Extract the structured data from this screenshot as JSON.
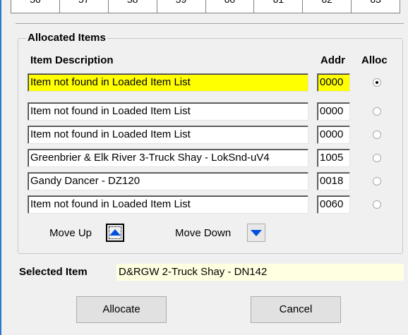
{
  "top_grid": {
    "cells": [
      "56",
      "57",
      "58",
      "59",
      "60",
      "61",
      "62",
      "63"
    ]
  },
  "allocated_items": {
    "group_title": "Allocated Items",
    "headers": {
      "description": "Item Description",
      "addr": "Addr",
      "alloc": "Alloc"
    },
    "rows": [
      {
        "description": "Item not found in Loaded Item List",
        "addr": "0000",
        "alloc_selected": true,
        "highlighted": true
      },
      {
        "description": "Item not found in Loaded Item List",
        "addr": "0000",
        "alloc_selected": false,
        "highlighted": false
      },
      {
        "description": "Item not found in Loaded Item List",
        "addr": "0000",
        "alloc_selected": false,
        "highlighted": false
      },
      {
        "description": "Greenbrier & Elk River 3-Truck Shay - LokSnd-uV4",
        "addr": "1005",
        "alloc_selected": false,
        "highlighted": false
      },
      {
        "description": "Gandy Dancer - DZ120",
        "addr": "0018",
        "alloc_selected": false,
        "highlighted": false
      },
      {
        "description": "Item not found in Loaded Item List",
        "addr": "0060",
        "alloc_selected": false,
        "highlighted": false
      }
    ],
    "move_up_label": "Move Up",
    "move_down_label": "Move Down"
  },
  "selected_item": {
    "label": "Selected Item",
    "value": "D&RGW 2-Truck Shay - DN142"
  },
  "buttons": {
    "allocate": "Allocate",
    "cancel": "Cancel"
  },
  "colors": {
    "highlight": "#ffff00",
    "selected_bg": "#ffffe1",
    "arrow": "#0050e0"
  },
  "icons": {
    "move_up": "triangle-up-icon",
    "move_down": "triangle-down-icon"
  }
}
